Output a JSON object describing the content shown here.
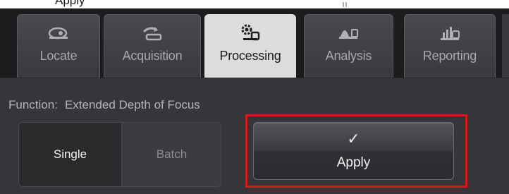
{
  "top": {
    "partial_text": "Apply"
  },
  "tabs": [
    {
      "label": "Locate",
      "icon": "locate-icon",
      "active": false
    },
    {
      "label": "Acquisition",
      "icon": "acquisition-icon",
      "active": false
    },
    {
      "label": "Processing",
      "icon": "processing-icon",
      "active": true
    },
    {
      "label": "Analysis",
      "icon": "analysis-icon",
      "active": false
    },
    {
      "label": "Reporting",
      "icon": "reporting-icon",
      "active": false
    }
  ],
  "function": {
    "label": "Function:",
    "value": "Extended Depth of Focus"
  },
  "mode": {
    "options": [
      "Single",
      "Batch"
    ],
    "selected": "Single"
  },
  "apply_button": {
    "label": "Apply",
    "icon": "checkmark-icon"
  },
  "colors": {
    "highlight": "#d61a1a",
    "active_tab": "#dcdcde",
    "panel": "#36363a"
  }
}
